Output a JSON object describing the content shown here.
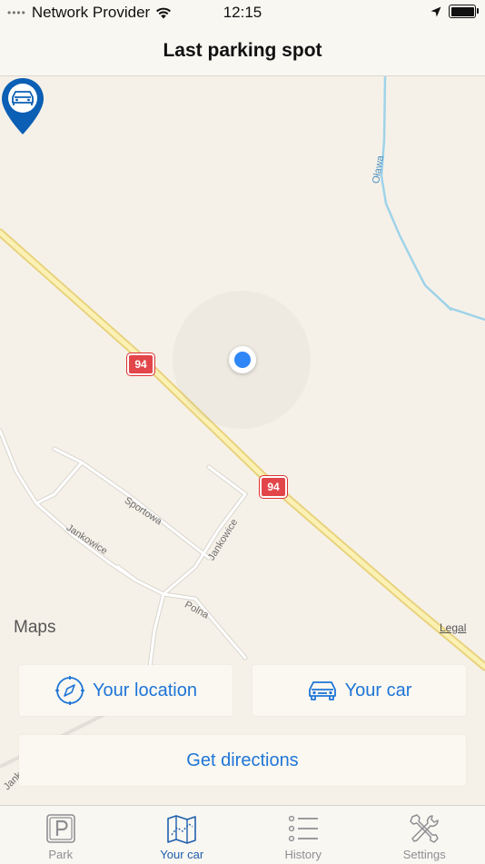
{
  "status_bar": {
    "carrier": "Network Provider",
    "time": "12:15"
  },
  "nav": {
    "title": "Last parking spot"
  },
  "map": {
    "labels": {
      "river": "Oława",
      "street_sportowa": "Sportowa",
      "street_jankowice_1": "Jankowice",
      "street_jankowice_2": "Jankowice",
      "street_polna": "Polna",
      "street_jank": "Jank"
    },
    "route_shields": [
      "94",
      "94"
    ],
    "provider": "Maps",
    "legal": "Legal"
  },
  "buttons": {
    "your_location": "Your location",
    "your_car": "Your car",
    "get_directions": "Get directions"
  },
  "tabs": [
    {
      "label": "Park",
      "icon": "parking-icon"
    },
    {
      "label": "Your car",
      "icon": "map-icon",
      "active": true
    },
    {
      "label": "History",
      "icon": "list-icon"
    },
    {
      "label": "Settings",
      "icon": "tools-icon"
    }
  ],
  "colors": {
    "accent": "#1e75d6",
    "active_tab": "#1e5fae",
    "user_location": "#2f86f6",
    "pin": "#0b5fb4",
    "route_shield": "#e2464a"
  }
}
